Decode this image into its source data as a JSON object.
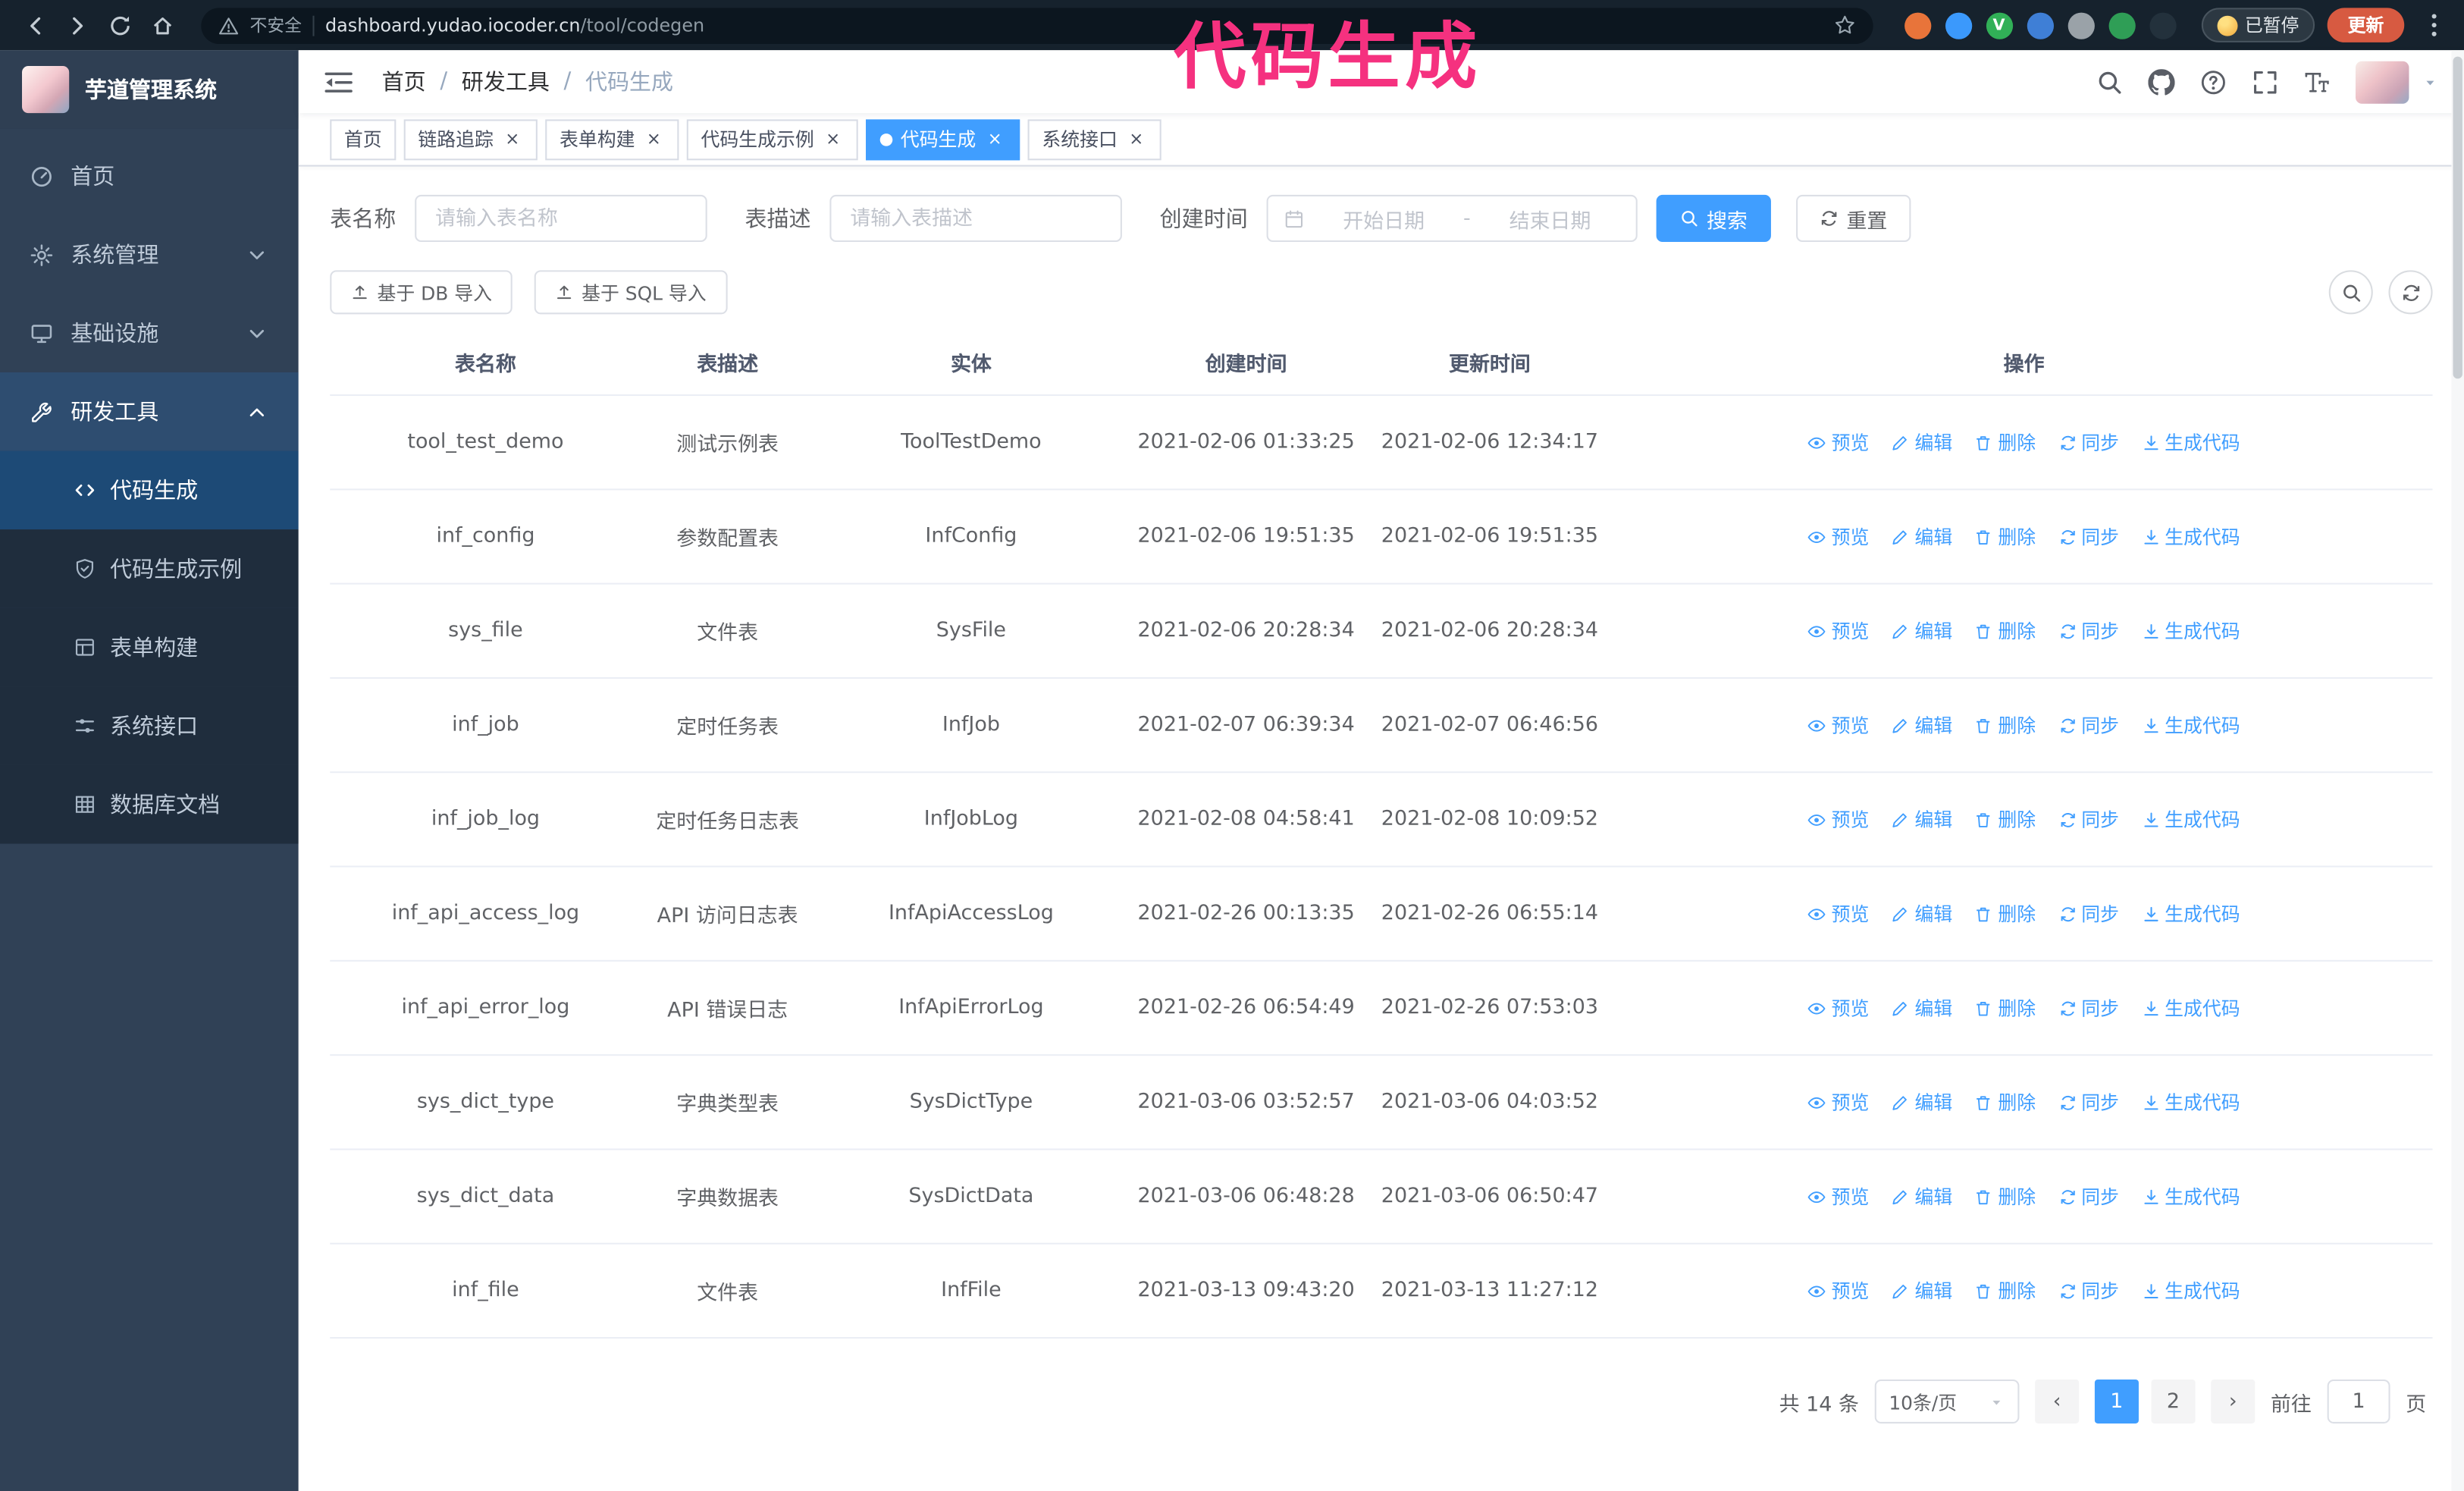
{
  "annotation": {
    "text": "代码生成",
    "color": "#f5317f"
  },
  "glyphs": {
    "tab_close": "×",
    "breadcrumb_sep": "/",
    "page_prev": "‹",
    "page_next": "›"
  },
  "colors": {
    "accent": "#409eff",
    "sidebar": "#304156",
    "chrome": "#16222d"
  },
  "browser_chrome": {
    "security_text": "不安全",
    "url_host": "dashboard.yudao.iocoder.cn",
    "url_path": "/tool/codegen",
    "paused_badge": "已暂停",
    "update_button": "更新",
    "extensions": [
      {
        "key": "fox",
        "color": "#e8743a",
        "glyph": ""
      },
      {
        "key": "blue",
        "color": "#3b99fc",
        "glyph": ""
      },
      {
        "key": "green-v",
        "color": "#31b057",
        "glyph": "V"
      },
      {
        "key": "people",
        "color": "#3f7fd6",
        "glyph": ""
      },
      {
        "key": "card",
        "color": "#9aa2a8",
        "glyph": ""
      },
      {
        "key": "leaf",
        "color": "#2f9e56",
        "glyph": ""
      },
      {
        "key": "paw",
        "color": "#23313c",
        "glyph": ""
      }
    ]
  },
  "sidebar": {
    "logo_title": "芋道管理系统",
    "menu": [
      {
        "key": "home",
        "label": "首页",
        "icon": "dashboard-icon",
        "expandable": false,
        "expanded": false
      },
      {
        "key": "system-mgmt",
        "label": "系统管理",
        "icon": "gear-icon",
        "expandable": true,
        "expanded": false
      },
      {
        "key": "infrastructure",
        "label": "基础设施",
        "icon": "infra-icon",
        "expandable": true,
        "expanded": false
      },
      {
        "key": "dev-tools",
        "label": "研发工具",
        "icon": "tools-icon",
        "expandable": true,
        "expanded": true
      }
    ],
    "submenu": [
      {
        "key": "codegen",
        "label": "代码生成",
        "icon": "code-icon",
        "active": true
      },
      {
        "key": "codegen-example",
        "label": "代码生成示例",
        "icon": "shield-check-icon",
        "active": false
      },
      {
        "key": "form-builder",
        "label": "表单构建",
        "icon": "form-icon",
        "active": false
      },
      {
        "key": "system-api",
        "label": "系统接口",
        "icon": "sliders-icon",
        "active": false
      },
      {
        "key": "db-doc",
        "label": "数据库文档",
        "icon": "table-grid-icon",
        "active": false
      }
    ]
  },
  "header": {
    "breadcrumb": [
      {
        "key": "home",
        "label": "首页",
        "current": false
      },
      {
        "key": "dev-tools",
        "label": "研发工具",
        "current": false
      },
      {
        "key": "codegen",
        "label": "代码生成",
        "current": true
      }
    ]
  },
  "tabs": [
    {
      "key": "home",
      "label": "首页",
      "closable": false,
      "active": false
    },
    {
      "key": "tracer",
      "label": "链路追踪",
      "closable": true,
      "active": false
    },
    {
      "key": "form-builder",
      "label": "表单构建",
      "closable": true,
      "active": false
    },
    {
      "key": "codegen-example",
      "label": "代码生成示例",
      "closable": true,
      "active": false
    },
    {
      "key": "codegen",
      "label": "代码生成",
      "closable": true,
      "active": true
    },
    {
      "key": "system-api",
      "label": "系统接口",
      "closable": true,
      "active": false
    }
  ],
  "filters": {
    "table_name_label": "表名称",
    "table_name_placeholder": "请输入表名称",
    "table_desc_label": "表描述",
    "table_desc_placeholder": "请输入表描述",
    "create_time_label": "创建时间",
    "date_start_placeholder": "开始日期",
    "date_separator": "-",
    "date_end_placeholder": "结束日期",
    "search_button": "搜索",
    "reset_button": "重置"
  },
  "toolbar": {
    "import_db": "基于 DB 导入",
    "import_sql": "基于 SQL 导入"
  },
  "table": {
    "columns": [
      "表名称",
      "表描述",
      "实体",
      "创建时间",
      "更新时间",
      "操作"
    ],
    "actions": [
      "预览",
      "编辑",
      "删除",
      "同步",
      "生成代码"
    ],
    "rows": [
      {
        "name": "tool_test_demo",
        "desc": "测试示例表",
        "entity": "ToolTestDemo",
        "created": "2021-02-06 01:33:25",
        "updated": "2021-02-06 12:34:17"
      },
      {
        "name": "inf_config",
        "desc": "参数配置表",
        "entity": "InfConfig",
        "created": "2021-02-06 19:51:35",
        "updated": "2021-02-06 19:51:35"
      },
      {
        "name": "sys_file",
        "desc": "文件表",
        "entity": "SysFile",
        "created": "2021-02-06 20:28:34",
        "updated": "2021-02-06 20:28:34"
      },
      {
        "name": "inf_job",
        "desc": "定时任务表",
        "entity": "InfJob",
        "created": "2021-02-07 06:39:34",
        "updated": "2021-02-07 06:46:56"
      },
      {
        "name": "inf_job_log",
        "desc": "定时任务日志表",
        "entity": "InfJobLog",
        "created": "2021-02-08 04:58:41",
        "updated": "2021-02-08 10:09:52"
      },
      {
        "name": "inf_api_access_log",
        "desc": "API 访问日志表",
        "entity": "InfApiAccessLog",
        "created": "2021-02-26 00:13:35",
        "updated": "2021-02-26 06:55:14"
      },
      {
        "name": "inf_api_error_log",
        "desc": "API 错误日志",
        "entity": "InfApiErrorLog",
        "created": "2021-02-26 06:54:49",
        "updated": "2021-02-26 07:53:03"
      },
      {
        "name": "sys_dict_type",
        "desc": "字典类型表",
        "entity": "SysDictType",
        "created": "2021-03-06 03:52:57",
        "updated": "2021-03-06 04:03:52"
      },
      {
        "name": "sys_dict_data",
        "desc": "字典数据表",
        "entity": "SysDictData",
        "created": "2021-03-06 06:48:28",
        "updated": "2021-03-06 06:50:47"
      },
      {
        "name": "inf_file",
        "desc": "文件表",
        "entity": "InfFile",
        "created": "2021-03-13 09:43:20",
        "updated": "2021-03-13 11:27:12"
      }
    ]
  },
  "pagination": {
    "total": "共 14 条",
    "page_size": "10条/页",
    "pages": [
      "1",
      "2"
    ],
    "active_page": "1",
    "goto_label": "前往",
    "goto_value": "1",
    "goto_suffix": "页"
  }
}
